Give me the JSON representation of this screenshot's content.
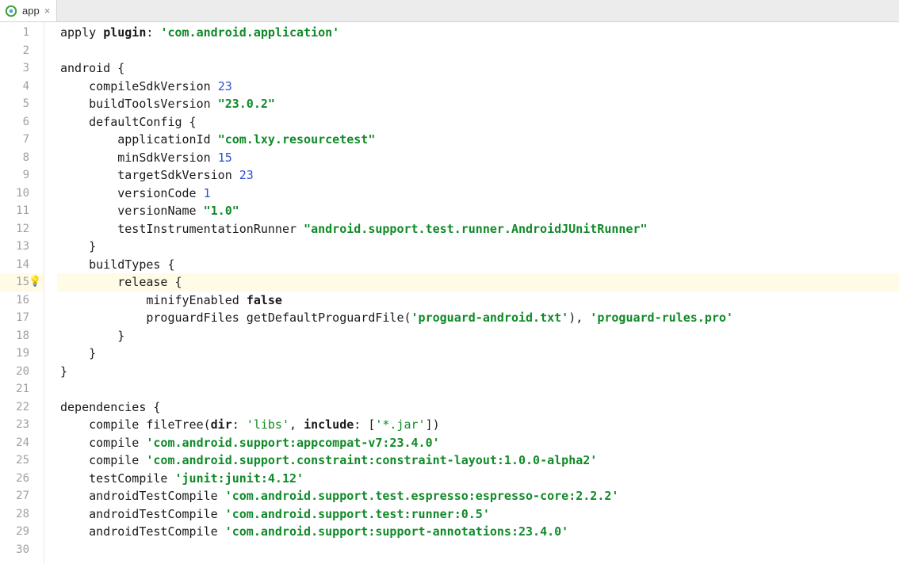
{
  "tab": {
    "label": "app"
  },
  "gutter": {
    "count": 30,
    "highlight_line": 15,
    "bulb_line": 15
  },
  "code": {
    "lines": [
      [
        {
          "t": "apply ",
          "c": "id"
        },
        {
          "t": "plugin",
          "c": "kw"
        },
        {
          "t": ": ",
          "c": "id"
        },
        {
          "t": "'com.android.application'",
          "c": "str"
        }
      ],
      [],
      [
        {
          "t": "android {",
          "c": "id"
        }
      ],
      [
        {
          "t": "    compileSdkVersion ",
          "c": "id"
        },
        {
          "t": "23",
          "c": "num"
        }
      ],
      [
        {
          "t": "    buildToolsVersion ",
          "c": "id"
        },
        {
          "t": "\"23.0.2\"",
          "c": "str"
        }
      ],
      [
        {
          "t": "    defaultConfig {",
          "c": "id"
        }
      ],
      [
        {
          "t": "        applicationId ",
          "c": "id"
        },
        {
          "t": "\"com.lxy.resourcetest\"",
          "c": "str"
        }
      ],
      [
        {
          "t": "        minSdkVersion ",
          "c": "id"
        },
        {
          "t": "15",
          "c": "num"
        }
      ],
      [
        {
          "t": "        targetSdkVersion ",
          "c": "id"
        },
        {
          "t": "23",
          "c": "num"
        }
      ],
      [
        {
          "t": "        versionCode ",
          "c": "id"
        },
        {
          "t": "1",
          "c": "num"
        }
      ],
      [
        {
          "t": "        versionName ",
          "c": "id"
        },
        {
          "t": "\"1.0\"",
          "c": "str"
        }
      ],
      [
        {
          "t": "        testInstrumentationRunner ",
          "c": "id"
        },
        {
          "t": "\"android.support.test.runner.AndroidJUnitRunner\"",
          "c": "str"
        }
      ],
      [
        {
          "t": "    }",
          "c": "id"
        }
      ],
      [
        {
          "t": "    buildTypes {",
          "c": "id"
        }
      ],
      [
        {
          "t": "        release {",
          "c": "id"
        }
      ],
      [
        {
          "t": "            minifyEnabled ",
          "c": "id"
        },
        {
          "t": "false",
          "c": "kw"
        }
      ],
      [
        {
          "t": "            proguardFiles getDefaultProguardFile(",
          "c": "id"
        },
        {
          "t": "'proguard-android.txt'",
          "c": "str"
        },
        {
          "t": "), ",
          "c": "id"
        },
        {
          "t": "'proguard-rules.pro'",
          "c": "str"
        }
      ],
      [
        {
          "t": "        }",
          "c": "id"
        }
      ],
      [
        {
          "t": "    }",
          "c": "id"
        }
      ],
      [
        {
          "t": "}",
          "c": "id"
        }
      ],
      [],
      [
        {
          "t": "dependencies {",
          "c": "id"
        }
      ],
      [
        {
          "t": "    compile fileTree(",
          "c": "id"
        },
        {
          "t": "dir",
          "c": "kw"
        },
        {
          "t": ": ",
          "c": "id"
        },
        {
          "t": "'libs'",
          "c": "strp"
        },
        {
          "t": ", ",
          "c": "id"
        },
        {
          "t": "include",
          "c": "kw"
        },
        {
          "t": ": [",
          "c": "id"
        },
        {
          "t": "'*.jar'",
          "c": "strp"
        },
        {
          "t": "])",
          "c": "id"
        }
      ],
      [
        {
          "t": "    compile ",
          "c": "id"
        },
        {
          "t": "'com.android.support:appcompat-v7:23.4.0'",
          "c": "str"
        }
      ],
      [
        {
          "t": "    compile ",
          "c": "id"
        },
        {
          "t": "'com.android.support.constraint:constraint-layout:1.0.0-alpha2'",
          "c": "str"
        }
      ],
      [
        {
          "t": "    testCompile ",
          "c": "id"
        },
        {
          "t": "'junit:junit:4.12'",
          "c": "str"
        }
      ],
      [
        {
          "t": "    androidTestCompile ",
          "c": "id"
        },
        {
          "t": "'com.android.support.test.espresso:espresso-core:2.2.2'",
          "c": "str"
        }
      ],
      [
        {
          "t": "    androidTestCompile ",
          "c": "id"
        },
        {
          "t": "'com.android.support.test:runner:0.5'",
          "c": "str"
        }
      ],
      [
        {
          "t": "    androidTestCompile ",
          "c": "id"
        },
        {
          "t": "'com.android.support:support-annotations:23.4.0'",
          "c": "str"
        }
      ],
      []
    ]
  }
}
